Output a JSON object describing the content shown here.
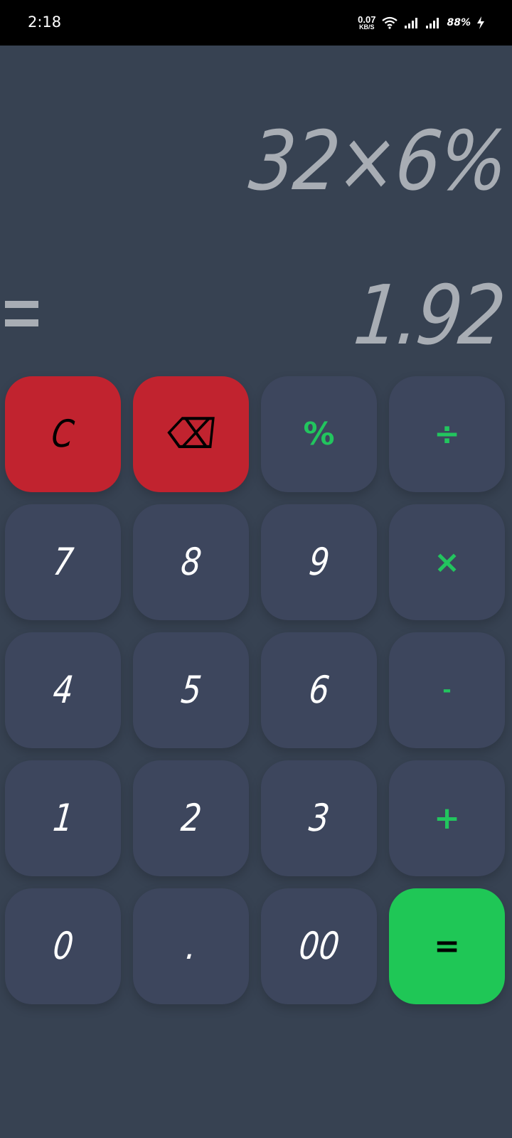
{
  "status_bar": {
    "time": "2:18",
    "net_speed_value": "0.07",
    "net_speed_unit": "KB/S",
    "battery": "88%",
    "icons": [
      "wifi-icon",
      "signal-icon",
      "signal-icon",
      "charging-bolt-icon"
    ]
  },
  "display": {
    "expression": "32×6%",
    "equals_symbol": "=",
    "result": "1.92"
  },
  "keypad": {
    "keys": [
      {
        "label": "C",
        "style": "red"
      },
      {
        "label": "⌫",
        "style": "red"
      },
      {
        "label": "%",
        "style": "op"
      },
      {
        "label": "÷",
        "style": "op"
      },
      {
        "label": "7",
        "style": "num"
      },
      {
        "label": "8",
        "style": "num"
      },
      {
        "label": "9",
        "style": "num"
      },
      {
        "label": "×",
        "style": "op"
      },
      {
        "label": "4",
        "style": "num"
      },
      {
        "label": "5",
        "style": "num"
      },
      {
        "label": "6",
        "style": "num"
      },
      {
        "label": "-",
        "style": "op"
      },
      {
        "label": "1",
        "style": "num"
      },
      {
        "label": "2",
        "style": "num"
      },
      {
        "label": "3",
        "style": "num"
      },
      {
        "label": "+",
        "style": "op"
      },
      {
        "label": "0",
        "style": "num"
      },
      {
        "label": ".",
        "style": "num"
      },
      {
        "label": "00",
        "style": "num"
      },
      {
        "label": "=",
        "style": "eq"
      }
    ]
  },
  "colors": {
    "background": "#374252",
    "key": "#3d465d",
    "clear_keys": "#c1232f",
    "equals_key": "#1fc756",
    "operator_text": "#22c55e",
    "display_text": "#a8adb4"
  }
}
